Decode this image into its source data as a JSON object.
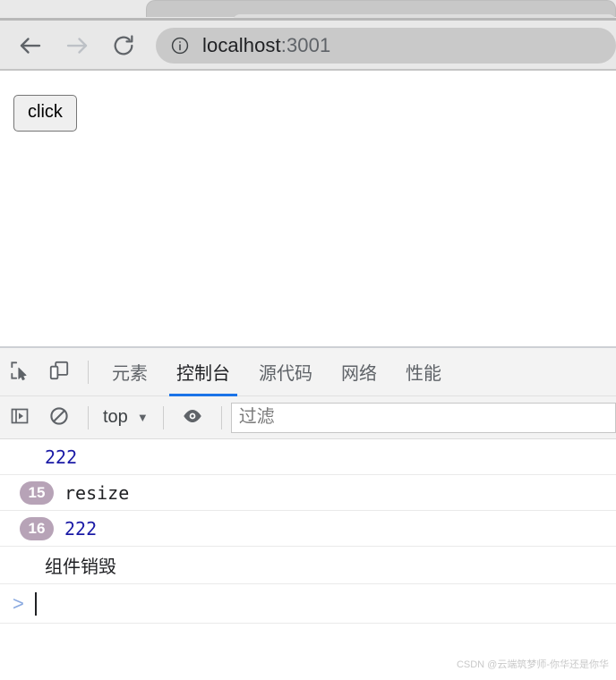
{
  "browser": {
    "tab_strip": {
      "active_tab_label": ""
    },
    "nav": {
      "back_label": "back-arrow",
      "forward_label": "forward-arrow",
      "reload_label": "reload"
    },
    "address_bar": {
      "info_icon": "info-icon",
      "host": "localhost",
      "port": ":3001",
      "full_url": "localhost:3001"
    }
  },
  "page": {
    "button_label": "click"
  },
  "devtools": {
    "toolbar_icons": {
      "inspect": "inspect-element-icon",
      "device": "device-toolbar-icon"
    },
    "tabs": [
      {
        "label": "元素",
        "active": false
      },
      {
        "label": "控制台",
        "active": true
      },
      {
        "label": "源代码",
        "active": false
      },
      {
        "label": "网络",
        "active": false
      },
      {
        "label": "性能",
        "active": false
      }
    ],
    "console_toolbar": {
      "sidebar_icon": "console-sidebar-icon",
      "clear_icon": "clear-console-icon",
      "context": "top",
      "context_caret": "▼",
      "eye_icon": "live-expression-eye-icon",
      "filter_placeholder": "过滤",
      "filter_value": ""
    },
    "console_messages": [
      {
        "count": "",
        "text": "222",
        "kind": "number"
      },
      {
        "count": "15",
        "text": "resize",
        "kind": "string"
      },
      {
        "count": "16",
        "text": "222",
        "kind": "number"
      },
      {
        "count": "",
        "text": "组件销毁",
        "kind": "cjk"
      }
    ],
    "prompt": {
      "chevron": ">",
      "value": ""
    }
  },
  "watermark": {
    "text": "CSDN @云端筑梦师-你华还是你华"
  },
  "colors": {
    "accent_blue": "#1a73e8",
    "number_blue": "#1a1aa6",
    "badge_mauve": "#b7a3b7",
    "chrome_grey": "#e8e8e8"
  }
}
